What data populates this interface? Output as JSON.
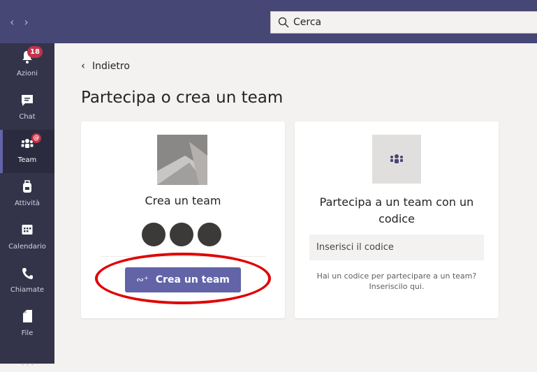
{
  "topbar": {
    "search_placeholder": "Cerca",
    "back_arrow_icon": "chevron-left-icon",
    "forward_arrow_icon": "chevron-right-icon"
  },
  "rail": {
    "items": [
      {
        "label": "Azioni",
        "icon": "bell-icon",
        "badge": "18"
      },
      {
        "label": "Chat",
        "icon": "chat-icon"
      },
      {
        "label": "Team",
        "icon": "teams-icon",
        "badge": "@",
        "active": true
      },
      {
        "label": "Attività",
        "icon": "backpack-icon"
      },
      {
        "label": "Calendario",
        "icon": "calendar-icon"
      },
      {
        "label": "Chiamate",
        "icon": "phone-icon"
      },
      {
        "label": "File",
        "icon": "file-icon"
      }
    ],
    "more": "···"
  },
  "main": {
    "back_label": "Indietro",
    "title": "Partecipa o crea un team",
    "create_card": {
      "title": "Crea un team",
      "button_label": "Crea un team",
      "button_icon": "add-people-icon"
    },
    "join_card": {
      "title": "Partecipa a un team con un codice",
      "input_placeholder": "Inserisci il codice",
      "hint": "Hai un codice per partecipare a un team? Inseriscilo qui."
    }
  },
  "colors": {
    "brand": "#6264a7",
    "topbar": "#464775",
    "rail": "#33344a",
    "badge": "#c4314b",
    "annotation": "#e00000"
  }
}
